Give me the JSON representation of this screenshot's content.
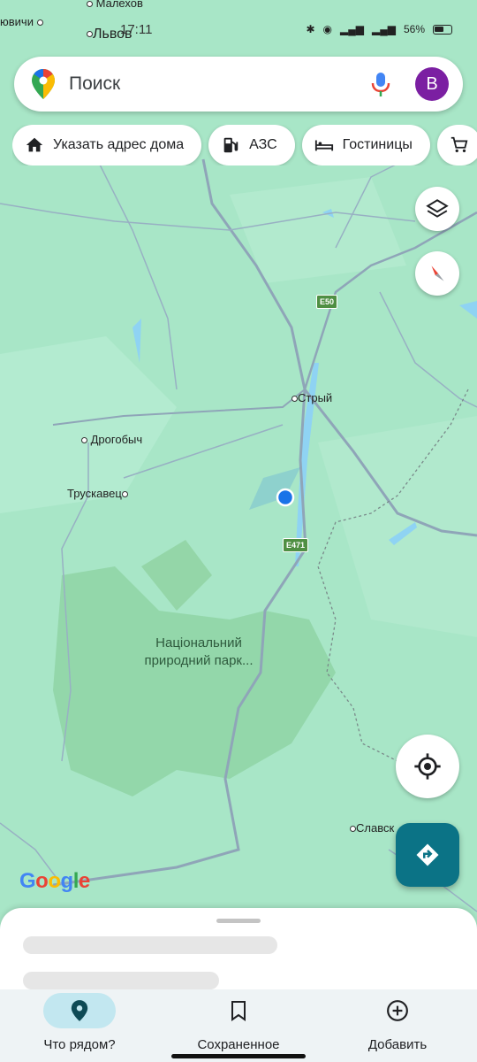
{
  "status_bar": {
    "time": "17:11",
    "battery": "56%"
  },
  "search": {
    "placeholder": "Поиск",
    "avatar_letter": "B"
  },
  "chips": [
    {
      "label": "Указать адрес дома",
      "icon": "home-icon"
    },
    {
      "label": "АЗС",
      "icon": "gas-station-icon"
    },
    {
      "label": "Гостиницы",
      "icon": "hotel-icon"
    },
    {
      "label": "",
      "icon": "shopping-cart-icon"
    }
  ],
  "map": {
    "places": {
      "lvov": "Львов",
      "malekhov": "Малехов",
      "partial_nw": "ювичи",
      "stryi": "Стрый",
      "drohobych": "Дрогобыч",
      "truskavets": "Трускавец",
      "park": "Національний природний парк...",
      "slavsk": "Славск"
    },
    "roads": {
      "e50": "E50",
      "e471": "E471"
    },
    "attribution": "Google"
  },
  "sheet": {
    "loading": true
  },
  "bottom_nav": [
    {
      "label": "Что рядом?",
      "icon": "location-pin-icon",
      "active": true
    },
    {
      "label": "Сохраненное",
      "icon": "bookmark-icon",
      "active": false
    },
    {
      "label": "Добавить",
      "icon": "add-circle-icon",
      "active": false
    }
  ],
  "colors": {
    "map_bg": "#a8e6c7",
    "park": "#8fd3a4",
    "road": "#8fa5b8",
    "water": "#8fd3f3",
    "avatar": "#7b1fa2",
    "directions": "#0b7386",
    "nav_active": "#c2e7f0",
    "location_dot": "#1a73e8"
  }
}
